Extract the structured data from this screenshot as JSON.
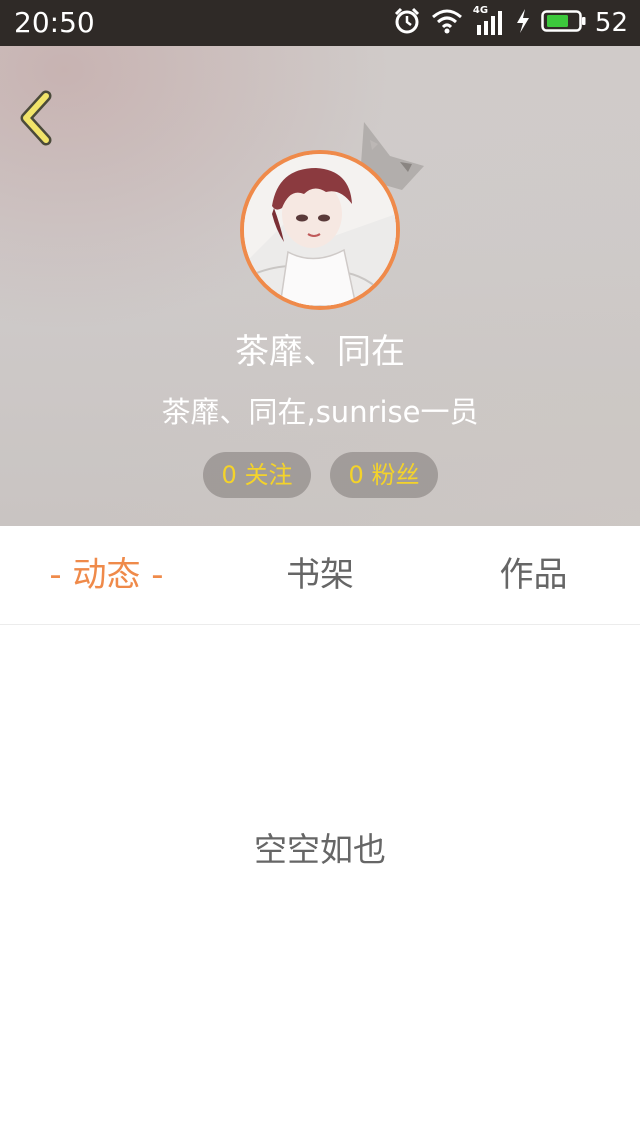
{
  "status_bar": {
    "time": "20:50",
    "network_label": "4G",
    "battery_level": "52",
    "icons": [
      "alarm-icon",
      "wifi-icon",
      "cellular-signal-icon",
      "charging-bolt-icon",
      "battery-icon"
    ],
    "battery_color": "#3cc83c"
  },
  "profile": {
    "name": "茶靡、同在",
    "bio": "茶靡、同在,sunrise一员",
    "following_label": "0 关注",
    "fans_label": "0 粉丝",
    "avatar_border_color": "#ef8a4a"
  },
  "tabs": [
    {
      "label": "- 动态 -",
      "active": true
    },
    {
      "label": "书架",
      "active": false
    },
    {
      "label": "作品",
      "active": false
    }
  ],
  "empty_state": {
    "text": "空空如也"
  },
  "colors": {
    "accent": "#ef8a4a",
    "stat_text": "#f4d32a",
    "back_arrow": "#f1e46a"
  }
}
